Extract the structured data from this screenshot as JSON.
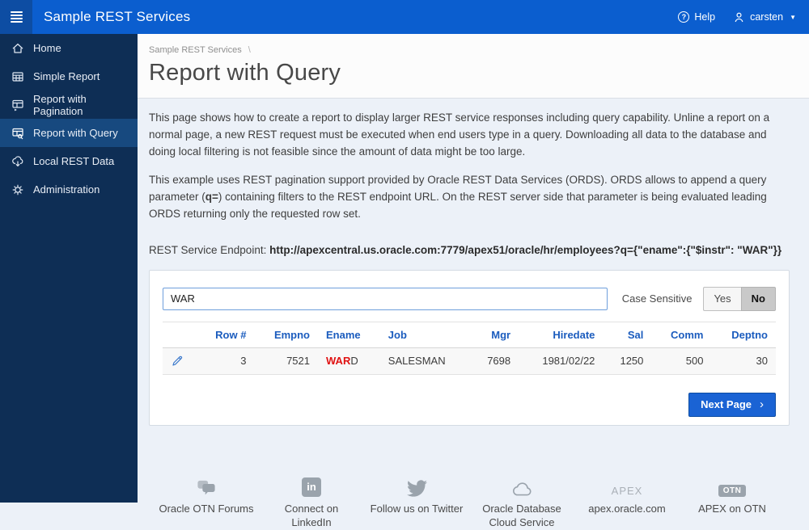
{
  "header": {
    "title": "Sample REST Services",
    "help_label": "Help",
    "help_icon_glyph": "?",
    "user_name": "carsten",
    "caret_glyph": "▼"
  },
  "sidebar": {
    "items": [
      {
        "icon": "home-icon",
        "label": "Home",
        "active": false
      },
      {
        "icon": "simple-report-icon",
        "label": "Simple Report",
        "active": false
      },
      {
        "icon": "report-pagination-icon",
        "label": "Report with Pagination",
        "active": false
      },
      {
        "icon": "report-query-icon",
        "label": "Report with Query",
        "active": true
      },
      {
        "icon": "local-rest-data-icon",
        "label": "Local REST Data",
        "active": false
      },
      {
        "icon": "administration-icon",
        "label": "Administration",
        "active": false
      }
    ]
  },
  "breadcrumb": {
    "text": "Sample REST Services",
    "separator": "\\"
  },
  "page": {
    "title": "Report with Query",
    "paragraph1": "This page shows how to create a report to display larger REST service responses including query capability. Unline a report on a normal page, a new REST request must be executed when end users type in a query. Downloading all data to the database and doing local filtering is not feasible since the amount of data might be too large.",
    "paragraph2_pre": "This example uses REST pagination support provided by Oracle REST Data Services (ORDS). ORDS allows to append a query parameter (",
    "paragraph2_bold": "q=",
    "paragraph2_post": ") containing filters to the REST endpoint URL. On the REST server side that parameter is being evaluated leading ORDS returning only the requested row set.",
    "endpoint_label": "REST Service Endpoint:",
    "endpoint_url": "http://apexcentral.us.oracle.com:7779/apex51/oracle/hr/employees?q={\"ename\":{\"$instr\": \"WAR\"}}"
  },
  "search": {
    "value": "WAR",
    "case_sensitive_label": "Case Sensitive",
    "yes_label": "Yes",
    "no_label": "No",
    "selected": "No"
  },
  "table": {
    "columns": [
      "Row #",
      "Empno",
      "Ename",
      "Job",
      "Mgr",
      "Hiredate",
      "Sal",
      "Comm",
      "Deptno"
    ],
    "row": {
      "row_num": "3",
      "empno": "7521",
      "ename_highlight": "WAR",
      "ename_rest": "D",
      "job": "SALESMAN",
      "mgr": "7698",
      "hiredate": "1981/02/22",
      "sal": "1250",
      "comm": "500",
      "deptno": "30"
    }
  },
  "pagination": {
    "next_label": "Next Page",
    "chevron_glyph": "›"
  },
  "footer": {
    "items": [
      {
        "icon": "forum-icon",
        "label": "Oracle OTN Forums"
      },
      {
        "icon": "linkedin-icon",
        "icon_text": "in",
        "label": "Connect on LinkedIn"
      },
      {
        "icon": "twitter-icon",
        "label": "Follow us on Twitter"
      },
      {
        "icon": "cloud-icon",
        "label": "Oracle Database Cloud Service"
      },
      {
        "icon": "apex-text-icon",
        "icon_text": "APEX",
        "label": "apex.oracle.com"
      },
      {
        "icon": "otn-badge-icon",
        "icon_text": "OTN",
        "label": "APEX on OTN"
      }
    ]
  },
  "colors": {
    "header_blue": "#0b5ecf",
    "hamburger_blue": "#0d4da3",
    "sidebar_navy": "#0e2e55",
    "sidebar_active_blue": "#17497f",
    "body_background": "#ecf1f8",
    "table_header_blue": "#1b5cbe",
    "highlight_red": "#e01212",
    "button_blue": "#1a63d4",
    "input_border_blue": "#6f9fdc",
    "footer_icon_gray": "#9aa3ac"
  }
}
